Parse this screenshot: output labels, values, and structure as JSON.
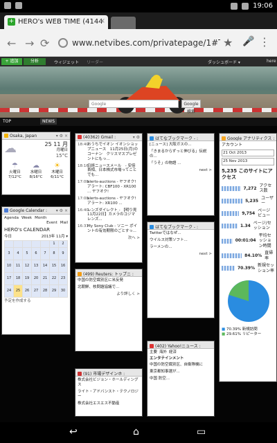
{
  "status": {
    "time": "19:06"
  },
  "browser": {
    "tab_title": "HERO's WEB TIME (4144",
    "url": "www.netvibes.com/privatepage/1#TOP"
  },
  "netvibes": {
    "add": "+ 追加",
    "analytics": "分析",
    "widget": "ウィジェット",
    "reader": "リーダー",
    "dashboard": "ダッシュボード ▾",
    "user": "here"
  },
  "banner": {
    "google_btn": "Google検索",
    "google_placeholder": "Google"
  },
  "subtabs": {
    "top": "TOP",
    "news": "NEWS"
  },
  "weather": {
    "title": "Osaka, Japan",
    "date": "25 11 月",
    "day": "月曜日",
    "temp": "15°C",
    "days": [
      {
        "name": "火曜日",
        "temp": "7/12°C"
      },
      {
        "name": "水曜日",
        "temp": "8/16°C"
      },
      {
        "name": "木曜日",
        "temp": "6/11°C"
      }
    ]
  },
  "calendar": {
    "title": "Google Calendar :",
    "views": [
      "Agenda",
      "Week",
      "Month"
    ],
    "extra": [
      "Event",
      "Mail"
    ],
    "heading": "HERO's CALENDAR",
    "month": "2013年 11月 ▾",
    "today_label": "予定を作成する",
    "weeks": [
      [
        "",
        "",
        "",
        "",
        "",
        "1",
        "2"
      ],
      [
        "3",
        "4",
        "5",
        "6",
        "7",
        "8",
        "9"
      ],
      [
        "10",
        "11",
        "12",
        "13",
        "14",
        "15",
        "16"
      ],
      [
        "17",
        "18",
        "19",
        "20",
        "21",
        "22",
        "23"
      ],
      [
        "24",
        "25",
        "26",
        "27",
        "28",
        "29",
        "30"
      ]
    ]
  },
  "gmail": {
    "title": "(40362) Gmail :",
    "more": "次へ >",
    "items": [
      {
        "time": "18:40",
        "text": "おうちでイオン イオンショップニュース　11月25日(月)のコーナン　クリスマスプレゼントにもっ..."
      },
      {
        "time": "18:16",
        "text": "日経ニュースメール　- 安倍首相、日本株式市場ってことでも..."
      },
      {
        "time": "17:08",
        "text": "alerts-auctions - ヤフオク!アラート: CBF100 - XR100 ... ヤフオク!"
      },
      {
        "time": "17:08",
        "text": "alerts-auctions - ヤフオク!アラート: XR100 ..."
      },
      {
        "time": "16:40",
        "text": "レンズダイレクト - 【明り見 11月22日】カメラのコジマ レンズ..."
      },
      {
        "time": "16:37",
        "text": "My Sony Club - ソニー ポイントの有効期限のごとすっ..."
      }
    ]
  },
  "reuters": {
    "title": "(499) Reuters: トップニ :",
    "more": "より詳しく >",
    "items": [
      "中国の防空識別区に米反発",
      "北朝鮮、核問題協議で..."
    ]
  },
  "bookmark1": {
    "title": "はてなブックマーク - :",
    "more": "next >",
    "items": [
      "[ニュース] 大阪ガスの...",
      "「きまるからずっと伸びる」伝説の...",
      "「うそ」の物語 ..."
    ]
  },
  "bookmark2": {
    "title": "はてなブックマーク - :",
    "more": "next >",
    "items": [
      "Twitterではなぜ...",
      "ウイルス対策ソフト...",
      "ラーメンの..."
    ]
  },
  "yahoo": {
    "title": "(402) Yahoo!ニュース :",
    "tabs": [
      "主要",
      "海外",
      "経済"
    ],
    "section": "エンタテインメント",
    "items": [
      "中国の防空識別区、自衛隊機に",
      "東京都知事選が...",
      "中国 防空..."
    ]
  },
  "ga": {
    "title": "Google アナリティクス :",
    "account": "アカウント",
    "date_from": "21 Oct 2013",
    "date_to": "25 Nov 2013",
    "heading": "5,235 このサイトにアクセス",
    "stats": [
      {
        "value": "7,272",
        "label": "アクセス数"
      },
      {
        "value": "5,235",
        "label": "ユーザー"
      },
      {
        "value": "9,754",
        "label": "ページビュー"
      },
      {
        "value": "1.34",
        "label": "ページ/セッション"
      },
      {
        "value": "00:01:04",
        "label": "平均セッション時間"
      },
      {
        "value": "84.10%",
        "label": "直帰率"
      },
      {
        "value": "70.39%",
        "label": "新規セッション率"
      }
    ],
    "legend": [
      {
        "value": "70.39%",
        "label": "新規訪問"
      },
      {
        "value": "29.61%",
        "label": "リピーター"
      }
    ]
  },
  "design": {
    "title": "(91) 市場デザインホ :",
    "items": [
      "株式会社ビジョン・ホールディングス",
      "ライト・アドバンスト・テクノロジー",
      "株式会社エスエス不動産"
    ]
  }
}
